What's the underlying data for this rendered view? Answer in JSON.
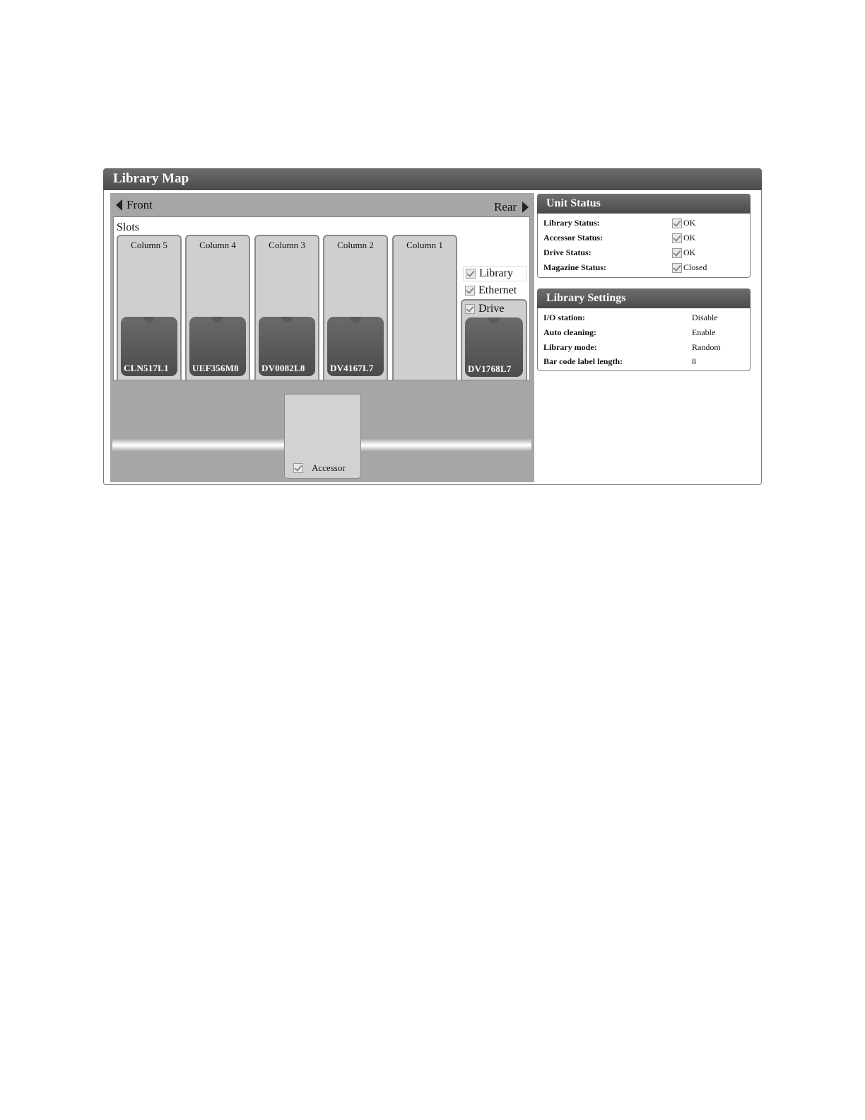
{
  "panel": {
    "title": "Library Map"
  },
  "map": {
    "nav_front": "Front",
    "nav_rear": "Rear",
    "slots_label": "Slots",
    "columns": [
      {
        "title": "Column 5",
        "cartridge": "CLN517L1"
      },
      {
        "title": "Column 4",
        "cartridge": "UEF356M8"
      },
      {
        "title": "Column 3",
        "cartridge": "DV0082L8"
      },
      {
        "title": "Column 2",
        "cartridge": "DV4167L7"
      },
      {
        "title": "Column 1",
        "cartridge": ""
      }
    ],
    "legend": {
      "library": "Library",
      "ethernet": "Ethernet",
      "drive": "Drive"
    },
    "drive_cartridge": "DV1768L7",
    "accessor": "Accessor"
  },
  "unit_status": {
    "title": "Unit Status",
    "rows": [
      {
        "label": "Library Status:",
        "value": "OK"
      },
      {
        "label": "Accessor Status:",
        "value": "OK"
      },
      {
        "label": "Drive Status:",
        "value": "OK"
      },
      {
        "label": "Magazine Status:",
        "value": "Closed"
      }
    ]
  },
  "library_settings": {
    "title": "Library Settings",
    "rows": [
      {
        "label": "I/O station:",
        "value": "Disable"
      },
      {
        "label": "Auto cleaning:",
        "value": "Enable"
      },
      {
        "label": "Library mode:",
        "value": "Random"
      },
      {
        "label": "Bar code label length:",
        "value": "8"
      }
    ]
  }
}
